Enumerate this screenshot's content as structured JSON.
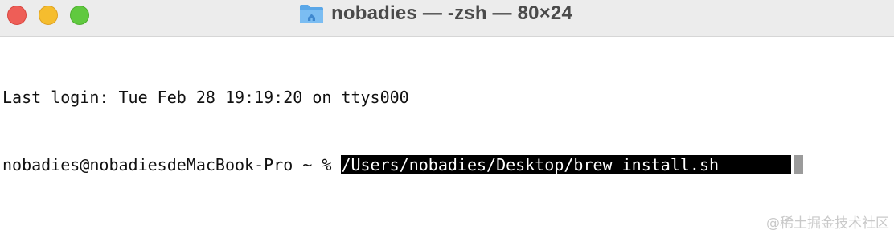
{
  "window": {
    "title": "nobadies — -zsh — 80×24"
  },
  "traffic_lights": {
    "close_color": "#ee5e57",
    "minimize_color": "#f5bd2e",
    "maximize_color": "#60c93f"
  },
  "icons": {
    "title_icon": "home-folder-icon"
  },
  "terminal": {
    "last_login": "Last login: Tue Feb 28 19:19:20 on ttys000",
    "prompt": "nobadies@nobadiesdeMacBook-Pro ~ % ",
    "command": "/Users/nobadies/Desktop/brew_install.sh"
  },
  "watermark": "@稀土掘金技术社区"
}
